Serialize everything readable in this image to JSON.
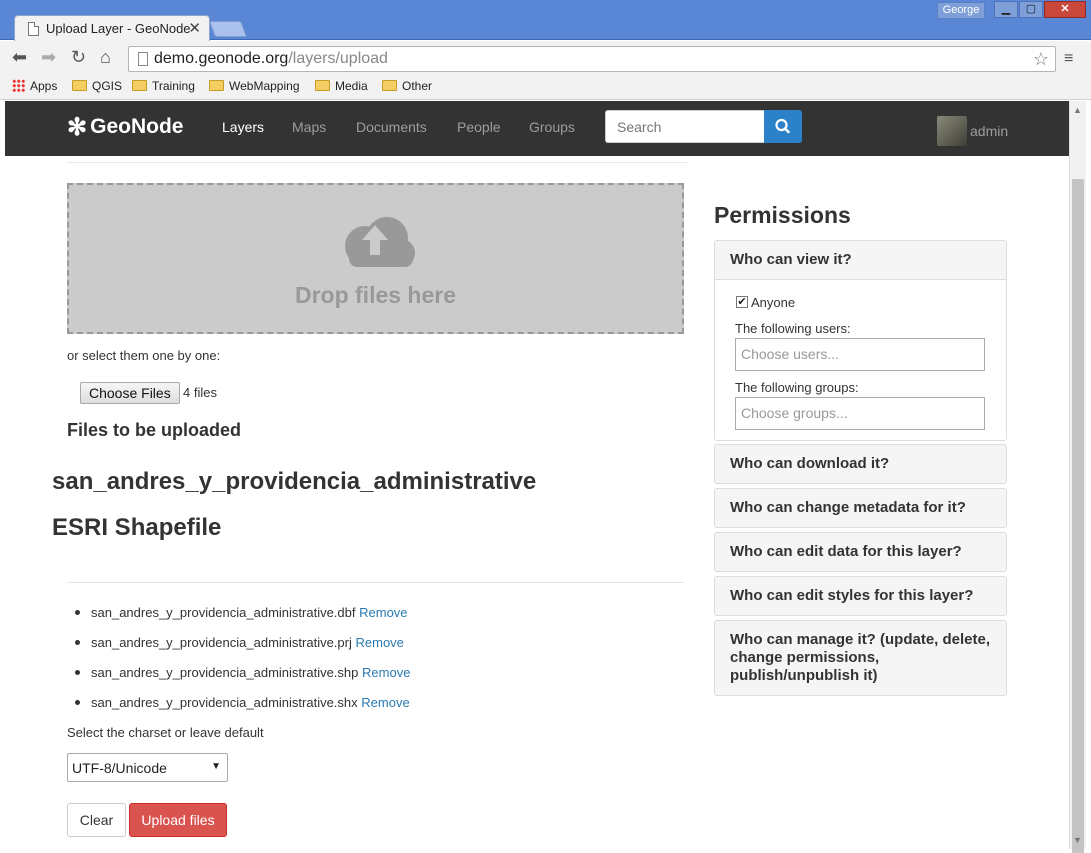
{
  "browser": {
    "tab_title": "Upload Layer - GeoNode",
    "tab_close": "✕",
    "user_badge": "George",
    "url_host": "demo.geonode.org",
    "url_path": "/layers/upload",
    "bookmarks": [
      "Apps",
      "QGIS",
      "Training",
      "WebMapping",
      "Media",
      "Other"
    ]
  },
  "navbar": {
    "brand": "GeoNode",
    "links": [
      "Layers",
      "Maps",
      "Documents",
      "People",
      "Groups"
    ],
    "active": "Layers",
    "search_placeholder": "Search",
    "user": "admin"
  },
  "upload": {
    "drop_text": "Drop files here",
    "select_text": "or select them one by one:",
    "choose_button": "Choose Files",
    "file_count": "4 files",
    "files_heading": "Files to be uploaded",
    "layer_name": "san_andres_y_providencia_administrative",
    "layer_type": "ESRI Shapefile",
    "files": [
      {
        "name": "san_andres_y_providencia_administrative.dbf",
        "action": "Remove"
      },
      {
        "name": "san_andres_y_providencia_administrative.prj",
        "action": "Remove"
      },
      {
        "name": "san_andres_y_providencia_administrative.shp",
        "action": "Remove"
      },
      {
        "name": "san_andres_y_providencia_administrative.shx",
        "action": "Remove"
      }
    ],
    "charset_label": "Select the charset or leave default",
    "charset_value": "UTF-8/Unicode",
    "clear_button": "Clear",
    "upload_button": "Upload files"
  },
  "permissions": {
    "title": "Permissions",
    "view": {
      "heading": "Who can view it?",
      "anyone_label": "Anyone",
      "anyone_checked": true,
      "users_label": "The following users:",
      "users_placeholder": "Choose users...",
      "groups_label": "The following groups:",
      "groups_placeholder": "Choose groups..."
    },
    "sections": [
      "Who can download it?",
      "Who can change metadata for it?",
      "Who can edit data for this layer?",
      "Who can edit styles for this layer?",
      "Who can manage it? (update, delete, change permissions, publish/unpublish it)"
    ]
  },
  "colors": {
    "navbar_bg": "#333333",
    "search_button": "#2c82c9",
    "upload_button": "#d9534f",
    "link": "#2a7ab0"
  }
}
